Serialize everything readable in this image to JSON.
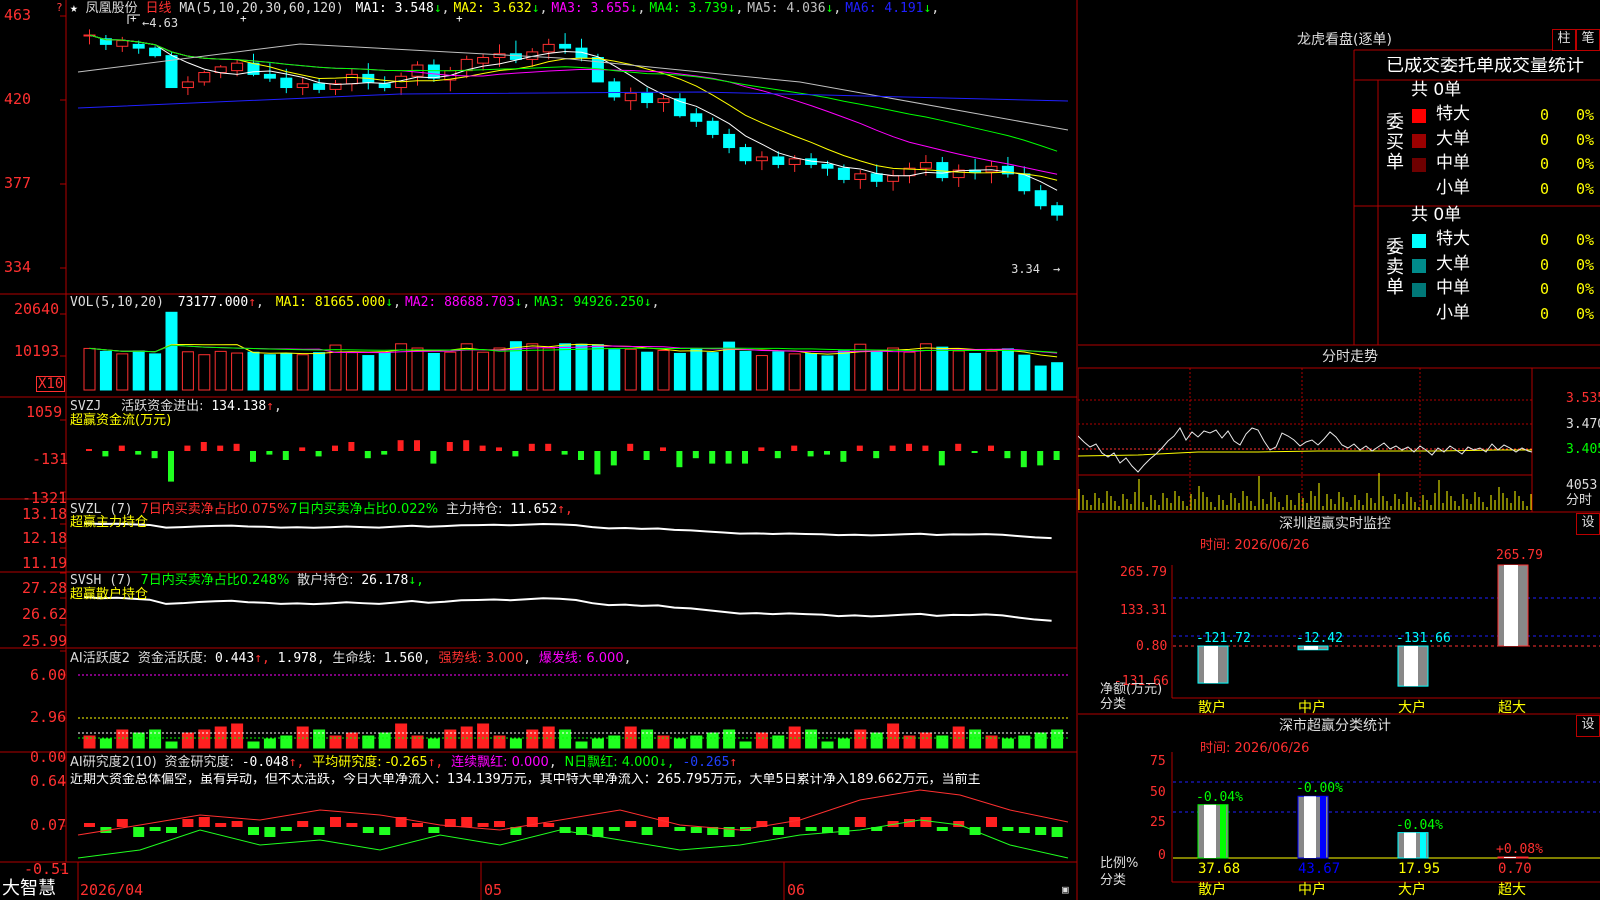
{
  "brand": "大智慧",
  "header": {
    "star": "★",
    "stock_name": "凤凰股份",
    "period": "日线",
    "ma_spec": "MA(5,10,20,30,60,120)",
    "ma": [
      {
        "label": "MA1:",
        "value": "3.548",
        "arrow": "↓",
        "color": "#ffffff"
      },
      {
        "label": "MA2:",
        "value": "3.632",
        "arrow": "↓",
        "color": "#ffff00"
      },
      {
        "label": "MA3:",
        "value": "3.655",
        "arrow": "↓",
        "color": "#ff00ff"
      },
      {
        "label": "MA4:",
        "value": "3.739",
        "arrow": "↓",
        "color": "#00ff00"
      },
      {
        "label": "MA5:",
        "value": "4.036",
        "arrow": "↓",
        "color": "#c0c0c0"
      },
      {
        "label": "MA6:",
        "value": "4.191",
        "arrow": "↓",
        "color": "#2020ff"
      }
    ],
    "high_mark": "4.63",
    "low_mark": "3.34"
  },
  "price_axis": [
    "463",
    "420",
    "377",
    "334"
  ],
  "volume": {
    "title": "VOL(5,10,20)",
    "value": "73177.000",
    "value_arrow": "↑",
    "ma": [
      {
        "label": "MA1:",
        "value": "81665.000",
        "arrow": "↓",
        "color": "#ffff00"
      },
      {
        "label": "MA2:",
        "value": "88688.703",
        "arrow": "↓",
        "color": "#ff00ff"
      },
      {
        "label": "MA3:",
        "value": "94926.250",
        "arrow": "↓",
        "color": "#00ff00"
      }
    ],
    "axis": [
      "20640",
      "10193"
    ],
    "multiplier": "X10"
  },
  "svzj": {
    "title": "SVZJ",
    "label": "活跃资金进出:",
    "value": "134.138",
    "arrow": "↑",
    "sub": "超赢资金流(万元)",
    "axis": [
      "1059",
      "-131",
      "-1321"
    ]
  },
  "svzl": {
    "title": "SVZL (7)",
    "a": "7日内买卖净占比0.075%",
    "b": "7日内买卖净占比0.022%",
    "c_label": "主力持仓:",
    "c_value": "11.652",
    "c_arrow": "↑,",
    "sub": "超赢主力持仓",
    "axis": [
      "13.18",
      "12.18",
      "11.19"
    ]
  },
  "svsh": {
    "title": "SVSH (7)",
    "a": "7日内买卖净占比0.248%",
    "c_label": "散户持仓:",
    "c_value": "26.178",
    "c_arrow": "↓,",
    "sub": "超赢散户持仓",
    "axis": [
      "27.28",
      "26.62",
      "25.99"
    ]
  },
  "ai1": {
    "title": "AI活跃度2",
    "label": "资金活跃度:",
    "v1": "0.443",
    "v2": "1.978",
    "v3_label": "生命线:",
    "v3": "1.560",
    "v4": "强势线: 3.000",
    "v5": "爆发线: 6.000",
    "axis": [
      "6.00",
      "2.96",
      "0.00"
    ]
  },
  "ai2": {
    "title": "AI研究度2(10)",
    "label": "资金研究度:",
    "v1": "-0.048",
    "v2": "平均研究度: -0.265",
    "v3": "连续飘红: 0.000",
    "v4": "N日飘红: 4.000",
    "v5": "-0.265",
    "text": "近期大资金总体偏空，虽有异动，但不太活跃，今日大单净流入：134.139万元，其中特大单净流入：265.795万元，大单5日累计净入189.662万元，当前主",
    "axis": [
      "0.64",
      "0.07",
      "-0.51"
    ]
  },
  "date_axis": [
    "2026/04",
    "05",
    "06"
  ],
  "dragon": {
    "title": "龙虎看盘(逐单)",
    "btn_bar": "柱",
    "btn_list": "笔",
    "header": "已成交委托单成交量统计",
    "buy_title": "委买单",
    "sell_title": "委卖单",
    "buy_total": "共 0单",
    "sell_total": "共 0单",
    "buy_rows": [
      {
        "name": "特大",
        "count": "0",
        "pct": "0%",
        "color": "#ff0000"
      },
      {
        "name": "大单",
        "count": "0",
        "pct": "0%",
        "color": "#9b0000"
      },
      {
        "name": "中单",
        "count": "0",
        "pct": "0%",
        "color": "#6e0000"
      },
      {
        "name": "小单",
        "count": "0",
        "pct": "0%",
        "color": "#000000"
      }
    ],
    "sell_rows": [
      {
        "name": "特大",
        "count": "0",
        "pct": "0%",
        "color": "#00ffff"
      },
      {
        "name": "大单",
        "count": "0",
        "pct": "0%",
        "color": "#008b8b"
      },
      {
        "name": "中单",
        "count": "0",
        "pct": "0%",
        "color": "#007878"
      },
      {
        "name": "小单",
        "count": "0",
        "pct": "0%",
        "color": "#000000"
      }
    ]
  },
  "intraday": {
    "title": "分时走势",
    "axis": [
      "3.535",
      "3.470",
      "3.405"
    ],
    "vol_value": "4053",
    "vol_label": "分时"
  },
  "monitor": {
    "title": "深圳超赢实时监控",
    "btn": "设",
    "date": "时间: 2026/06/26",
    "axis": [
      "265.79",
      "133.31",
      "0.80",
      "-131.66"
    ],
    "ylabel1": "净额(万元)",
    "ylabel2": "分类",
    "categories": [
      "散户",
      "中户",
      "大户",
      "超大"
    ],
    "values": [
      "-121.72",
      "-12.42",
      "-131.66",
      "265.79"
    ]
  },
  "classstat": {
    "title": "深市超赢分类统计",
    "btn": "设",
    "date": "时间: 2026/06/26",
    "axis": [
      "75",
      "50",
      "25",
      "0"
    ],
    "ylabel1": "比例%",
    "ylabel2": "分类",
    "categories": [
      "散户",
      "中户",
      "大户",
      "超大"
    ],
    "changes": [
      "-0.04%",
      "-0.00%",
      "-0.04%",
      "+0.08%"
    ],
    "ratios": [
      "37.68",
      "43.67",
      "17.95",
      "0.70"
    ]
  },
  "chart_data": {
    "type": "candlestick",
    "note_series": "daily candles 2026/04 - 2026/06",
    "ohlc": [
      [
        4.55,
        4.58,
        4.5,
        4.55
      ],
      [
        4.53,
        4.55,
        4.47,
        4.5
      ],
      [
        4.49,
        4.54,
        4.46,
        4.52
      ],
      [
        4.5,
        4.52,
        4.45,
        4.48
      ],
      [
        4.48,
        4.49,
        4.43,
        4.44
      ],
      [
        4.44,
        4.46,
        4.27,
        4.27
      ],
      [
        4.27,
        4.33,
        4.23,
        4.3
      ],
      [
        4.3,
        4.36,
        4.28,
        4.35
      ],
      [
        4.35,
        4.39,
        4.32,
        4.38
      ],
      [
        4.36,
        4.42,
        4.33,
        4.4
      ],
      [
        4.4,
        4.45,
        4.33,
        4.34
      ],
      [
        4.34,
        4.4,
        4.3,
        4.32
      ],
      [
        4.32,
        4.37,
        4.24,
        4.27
      ],
      [
        4.27,
        4.32,
        4.23,
        4.29
      ],
      [
        4.29,
        4.32,
        4.24,
        4.26
      ],
      [
        4.26,
        4.31,
        4.23,
        4.29
      ],
      [
        4.29,
        4.37,
        4.25,
        4.34
      ],
      [
        4.34,
        4.4,
        4.26,
        4.3
      ],
      [
        4.29,
        4.33,
        4.25,
        4.27
      ],
      [
        4.27,
        4.35,
        4.23,
        4.33
      ],
      [
        4.33,
        4.41,
        4.28,
        4.39
      ],
      [
        4.39,
        4.42,
        4.3,
        4.32
      ],
      [
        4.31,
        4.38,
        4.25,
        4.36
      ],
      [
        4.36,
        4.44,
        4.32,
        4.42
      ],
      [
        4.4,
        4.45,
        4.36,
        4.43
      ],
      [
        4.43,
        4.5,
        4.38,
        4.45
      ],
      [
        4.45,
        4.52,
        4.4,
        4.42
      ],
      [
        4.42,
        4.48,
        4.38,
        4.46
      ],
      [
        4.46,
        4.53,
        4.42,
        4.5
      ],
      [
        4.5,
        4.56,
        4.45,
        4.48
      ],
      [
        4.48,
        4.53,
        4.41,
        4.43
      ],
      [
        4.43,
        4.45,
        4.3,
        4.3
      ],
      [
        4.3,
        4.32,
        4.2,
        4.22
      ],
      [
        4.2,
        4.27,
        4.15,
        4.24
      ],
      [
        4.24,
        4.27,
        4.16,
        4.19
      ],
      [
        4.19,
        4.23,
        4.14,
        4.21
      ],
      [
        4.21,
        4.24,
        4.11,
        4.12
      ],
      [
        4.13,
        4.16,
        4.06,
        4.09
      ],
      [
        4.09,
        4.11,
        4.0,
        4.02
      ],
      [
        4.02,
        4.05,
        3.92,
        3.95
      ],
      [
        3.95,
        3.97,
        3.86,
        3.88
      ],
      [
        3.88,
        3.93,
        3.83,
        3.9
      ],
      [
        3.9,
        3.93,
        3.84,
        3.86
      ],
      [
        3.86,
        3.91,
        3.82,
        3.89
      ],
      [
        3.89,
        3.92,
        3.84,
        3.86
      ],
      [
        3.86,
        3.88,
        3.8,
        3.84
      ],
      [
        3.84,
        3.86,
        3.76,
        3.78
      ],
      [
        3.78,
        3.83,
        3.73,
        3.81
      ],
      [
        3.81,
        3.86,
        3.74,
        3.77
      ],
      [
        3.77,
        3.83,
        3.72,
        3.8
      ],
      [
        3.8,
        3.87,
        3.76,
        3.84
      ],
      [
        3.84,
        3.91,
        3.8,
        3.87
      ],
      [
        3.87,
        3.9,
        3.77,
        3.79
      ],
      [
        3.79,
        3.86,
        3.74,
        3.83
      ],
      [
        3.83,
        3.89,
        3.78,
        3.82
      ],
      [
        3.82,
        3.88,
        3.76,
        3.85
      ],
      [
        3.85,
        3.9,
        3.79,
        3.81
      ],
      [
        3.81,
        3.85,
        3.7,
        3.72
      ],
      [
        3.72,
        3.75,
        3.62,
        3.64
      ],
      [
        3.64,
        3.66,
        3.56,
        3.59
      ]
    ],
    "volume_x10": [
      9.9,
      9.2,
      8.6,
      9.3,
      8.6,
      18.5,
      9.1,
      8.4,
      9.2,
      8.8,
      9.0,
      8.4,
      8.7,
      8.4,
      8.9,
      10.7,
      8.9,
      8.2,
      8.9,
      11.0,
      10.0,
      8.7,
      9.0,
      11.0,
      9.0,
      10.0,
      11.5,
      11.0,
      10.0,
      11.0,
      10.9,
      10.8,
      9.6,
      9.7,
      9.0,
      9.4,
      8.7,
      9.9,
      8.9,
      11.4,
      9.2,
      8.2,
      9.1,
      8.6,
      8.7,
      8.1,
      9.3,
      10.9,
      9.2,
      10.0,
      9.0,
      11.0,
      10.2,
      9.3,
      8.7,
      9.2,
      9.8,
      8.3,
      5.7,
      6.5
    ],
    "price_range": [
      3.34,
      4.63
    ]
  }
}
